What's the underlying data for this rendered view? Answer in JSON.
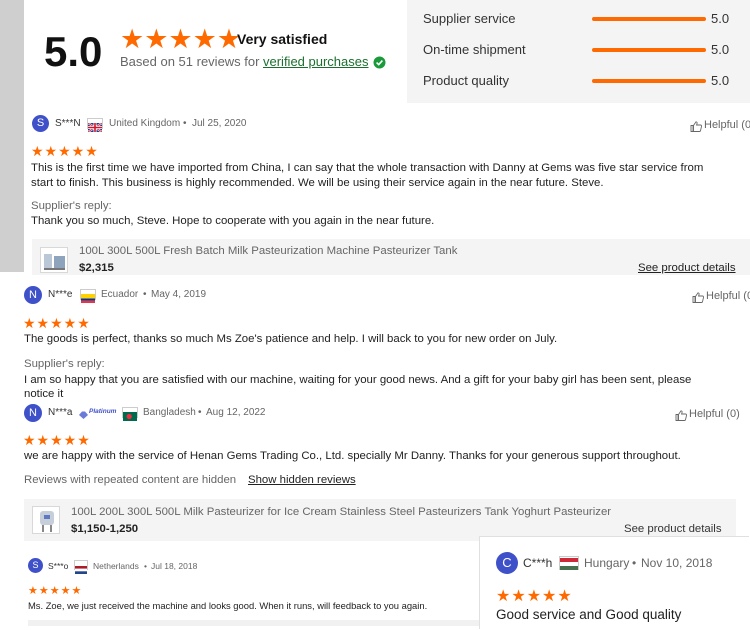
{
  "summary": {
    "score": "5.0",
    "stars": "★★★★★",
    "label": "Very satisfied",
    "based_on": "Based on 51 reviews for",
    "verified_link": "verified purchases",
    "check_icon": "verified-check-icon",
    "accent_color": "#ff6a00"
  },
  "ratings": [
    {
      "label": "Supplier service",
      "value": "5.0",
      "fill": 1.0
    },
    {
      "label": "On-time shipment",
      "value": "5.0",
      "fill": 1.0
    },
    {
      "label": "Product quality",
      "value": "5.0",
      "fill": 1.0
    }
  ],
  "reviews": [
    {
      "initial": "S",
      "name": "S***N",
      "flag": "uk-flag",
      "country": "United Kingdom",
      "date": "Jul 25, 2020",
      "helpful": "Helpful (0",
      "stars": "★★★★★",
      "text1": "This is the first time we have imported from China, I can say that the whole transaction with Danny at Gems was five star service from",
      "text2": "start to finish. This business is highly recommended. We will be using their service again in the near future. Steve.",
      "reply_label": "Supplier's reply:",
      "reply": "Thank you so much, Steve. Hope to cooperate with you again in the near future.",
      "product": "100L 300L 500L Fresh Batch Milk Pasteurization Machine Pasteurizer Tank",
      "price": "$2,315",
      "details": "See product details"
    },
    {
      "initial": "N",
      "name": "N***e",
      "flag": "ecuador-flag",
      "country": "Ecuador",
      "date": "May 4, 2019",
      "helpful": "Helpful (0",
      "stars": "★★★★★",
      "text1": "The goods is perfect, thanks so much Ms Zoe's patience and help. I will back to you for new order on July.",
      "reply_label": "Supplier's reply:",
      "reply": "I am so happy that you are satisfied with our machine, waiting for your good news. And a gift for your baby girl has been sent, please",
      "reply_cut": "notice it"
    },
    {
      "initial": "N",
      "name": "N***a",
      "badge": "Platinum",
      "flag": "bangladesh-flag",
      "country": "Bangladesh",
      "date": "Aug 12, 2022",
      "helpful": "Helpful (0)",
      "stars": "★★★★★",
      "text1": "we are happy with the service of Henan Gems Trading Co., Ltd. specially Mr Danny. Thanks for your generous support throughout.",
      "hidden_note": "Reviews with repeated content are hidden",
      "hidden_link": "Show hidden reviews",
      "product": "100L 200L 300L 500L Milk Pasteurizer for Ice Cream Stainless Steel Pasteurizers Tank Yoghurt Pasteurizer",
      "price": "$1,150-1,250",
      "details": "See product details"
    },
    {
      "initial": "S",
      "name": "S***o",
      "flag": "netherlands-flag",
      "country": "Netherlands",
      "date": "Jul 18, 2018",
      "stars": "★★★★★",
      "text1": "Ms. Zoe, we just received the machine and looks good. When it runs, will feedback to you again."
    },
    {
      "initial": "C",
      "name": "C***h",
      "flag": "hungary-flag",
      "country": "Hungary",
      "date": "Nov 10, 2018",
      "stars": "★★★★★",
      "text1": "Good service and Good quality"
    }
  ],
  "dot": "•"
}
